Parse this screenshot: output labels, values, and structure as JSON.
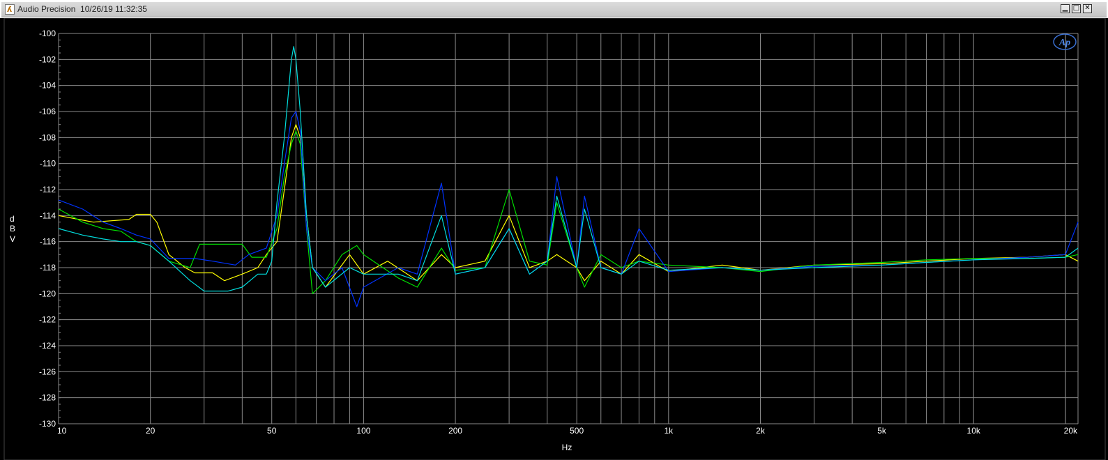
{
  "window": {
    "title": "Audio Precision  10/26/19 11:32:35",
    "icon": "audio-precision-app-icon",
    "buttons": [
      "minimize",
      "maximize",
      "close"
    ]
  },
  "logo": {
    "text": "AP"
  },
  "chart_data": {
    "type": "line",
    "title": "",
    "xlabel": "Hz",
    "ylabel": "dBV",
    "x_scale": "log",
    "xlim": [
      10,
      22000
    ],
    "ylim": [
      -130,
      -100
    ],
    "grid": true,
    "x_tick_labels": [
      {
        "value": 10,
        "label": "10"
      },
      {
        "value": 20,
        "label": "20"
      },
      {
        "value": 50,
        "label": "50"
      },
      {
        "value": 100,
        "label": "100"
      },
      {
        "value": 200,
        "label": "200"
      },
      {
        "value": 500,
        "label": "500"
      },
      {
        "value": 1000,
        "label": "1k"
      },
      {
        "value": 2000,
        "label": "2k"
      },
      {
        "value": 5000,
        "label": "5k"
      },
      {
        "value": 10000,
        "label": "10k"
      },
      {
        "value": 20000,
        "label": "20k"
      }
    ],
    "y_ticks": [
      -100,
      -102,
      -104,
      -106,
      -108,
      -110,
      -112,
      -114,
      -116,
      -118,
      -120,
      -122,
      -124,
      -126,
      -128,
      -130
    ],
    "colors": {
      "background": "#000000",
      "grid": "#8a8a8a",
      "text": "#ffffff"
    },
    "series": [
      {
        "color": "#ffff00",
        "points": [
          [
            10,
            -114
          ],
          [
            13,
            -114.5
          ],
          [
            17,
            -114.3
          ],
          [
            18,
            -113.9
          ],
          [
            20,
            -113.9
          ],
          [
            21,
            -114.5
          ],
          [
            23,
            -117
          ],
          [
            26,
            -118
          ],
          [
            28,
            -118.4
          ],
          [
            32,
            -118.4
          ],
          [
            35,
            -119
          ],
          [
            40,
            -118.5
          ],
          [
            45,
            -118
          ],
          [
            48,
            -117
          ],
          [
            52,
            -116
          ],
          [
            55,
            -112
          ],
          [
            58,
            -108
          ],
          [
            60,
            -107
          ],
          [
            62,
            -108
          ],
          [
            65,
            -114
          ],
          [
            68,
            -118
          ],
          [
            75,
            -119.5
          ],
          [
            90,
            -117
          ],
          [
            100,
            -118.5
          ],
          [
            120,
            -117.5
          ],
          [
            150,
            -119
          ],
          [
            180,
            -117
          ],
          [
            200,
            -118
          ],
          [
            250,
            -117.5
          ],
          [
            300,
            -114
          ],
          [
            350,
            -118
          ],
          [
            400,
            -117.5
          ],
          [
            430,
            -117
          ],
          [
            500,
            -118
          ],
          [
            530,
            -119
          ],
          [
            600,
            -117.5
          ],
          [
            700,
            -118.5
          ],
          [
            800,
            -117
          ],
          [
            1000,
            -118.3
          ],
          [
            1500,
            -117.8
          ],
          [
            2000,
            -118.2
          ],
          [
            3000,
            -117.8
          ],
          [
            5000,
            -117.7
          ],
          [
            7000,
            -117.5
          ],
          [
            10000,
            -117.3
          ],
          [
            15000,
            -117.2
          ],
          [
            20000,
            -117
          ],
          [
            22000,
            -117.5
          ]
        ]
      },
      {
        "color": "#00dd00",
        "points": [
          [
            10,
            -113.5
          ],
          [
            12,
            -114.5
          ],
          [
            14,
            -115
          ],
          [
            16,
            -115.2
          ],
          [
            18,
            -116
          ],
          [
            20,
            -116.3
          ],
          [
            23,
            -117.5
          ],
          [
            27,
            -118
          ],
          [
            29,
            -116.2
          ],
          [
            35,
            -116.2
          ],
          [
            40,
            -116.2
          ],
          [
            43,
            -117.2
          ],
          [
            48,
            -117.2
          ],
          [
            52,
            -115
          ],
          [
            55,
            -111
          ],
          [
            58,
            -108.5
          ],
          [
            60,
            -107.5
          ],
          [
            62,
            -108.5
          ],
          [
            65,
            -115
          ],
          [
            68,
            -120
          ],
          [
            75,
            -119
          ],
          [
            85,
            -117
          ],
          [
            95,
            -116.3
          ],
          [
            100,
            -117
          ],
          [
            130,
            -118.8
          ],
          [
            150,
            -119.5
          ],
          [
            180,
            -116.5
          ],
          [
            200,
            -118.2
          ],
          [
            250,
            -118
          ],
          [
            300,
            -112
          ],
          [
            350,
            -117.5
          ],
          [
            400,
            -117.8
          ],
          [
            430,
            -113
          ],
          [
            500,
            -118
          ],
          [
            530,
            -119.5
          ],
          [
            600,
            -117
          ],
          [
            700,
            -118
          ],
          [
            800,
            -117.5
          ],
          [
            1000,
            -117.8
          ],
          [
            1500,
            -118
          ],
          [
            2000,
            -118.3
          ],
          [
            3000,
            -117.8
          ],
          [
            5000,
            -117.6
          ],
          [
            7000,
            -117.4
          ],
          [
            10000,
            -117.3
          ],
          [
            15000,
            -117.3
          ],
          [
            20000,
            -117.2
          ],
          [
            22000,
            -117
          ]
        ]
      },
      {
        "color": "#0033ff",
        "points": [
          [
            10,
            -112.8
          ],
          [
            12,
            -113.5
          ],
          [
            14,
            -114.5
          ],
          [
            16,
            -115
          ],
          [
            18,
            -115.5
          ],
          [
            20,
            -115.8
          ],
          [
            23,
            -117.3
          ],
          [
            28,
            -117.3
          ],
          [
            32,
            -117.5
          ],
          [
            38,
            -117.8
          ],
          [
            42,
            -117
          ],
          [
            48,
            -116.5
          ],
          [
            52,
            -114
          ],
          [
            55,
            -110
          ],
          [
            58,
            -106.5
          ],
          [
            60,
            -106
          ],
          [
            62,
            -107.5
          ],
          [
            65,
            -115
          ],
          [
            68,
            -118
          ],
          [
            75,
            -119
          ],
          [
            85,
            -118
          ],
          [
            95,
            -121
          ],
          [
            100,
            -119.5
          ],
          [
            130,
            -118
          ],
          [
            150,
            -118.5
          ],
          [
            180,
            -111.5
          ],
          [
            200,
            -118.5
          ],
          [
            250,
            -118
          ],
          [
            300,
            -115
          ],
          [
            350,
            -118.5
          ],
          [
            400,
            -117.5
          ],
          [
            430,
            -111
          ],
          [
            500,
            -118
          ],
          [
            530,
            -112.5
          ],
          [
            600,
            -118
          ],
          [
            700,
            -118.5
          ],
          [
            800,
            -115
          ],
          [
            1000,
            -118.3
          ],
          [
            1500,
            -118
          ],
          [
            2000,
            -118.2
          ],
          [
            3000,
            -117.9
          ],
          [
            5000,
            -117.8
          ],
          [
            7000,
            -117.6
          ],
          [
            10000,
            -117.4
          ],
          [
            15000,
            -117.2
          ],
          [
            20000,
            -117
          ],
          [
            22000,
            -114.5
          ]
        ]
      },
      {
        "color": "#00dddd",
        "points": [
          [
            10,
            -115
          ],
          [
            12,
            -115.5
          ],
          [
            14,
            -115.8
          ],
          [
            16,
            -116
          ],
          [
            18,
            -116
          ],
          [
            20,
            -116.3
          ],
          [
            23,
            -117.5
          ],
          [
            27,
            -119
          ],
          [
            30,
            -119.8
          ],
          [
            36,
            -119.8
          ],
          [
            40,
            -119.5
          ],
          [
            45,
            -118.5
          ],
          [
            48,
            -118.5
          ],
          [
            50,
            -117.5
          ],
          [
            52,
            -113
          ],
          [
            55,
            -108
          ],
          [
            58,
            -102
          ],
          [
            59,
            -101
          ],
          [
            60,
            -102
          ],
          [
            62,
            -106
          ],
          [
            65,
            -114
          ],
          [
            68,
            -118
          ],
          [
            75,
            -119.5
          ],
          [
            90,
            -118
          ],
          [
            100,
            -118.5
          ],
          [
            130,
            -118.5
          ],
          [
            150,
            -119
          ],
          [
            180,
            -114
          ],
          [
            200,
            -118.5
          ],
          [
            250,
            -118
          ],
          [
            300,
            -115
          ],
          [
            350,
            -118.5
          ],
          [
            400,
            -117.5
          ],
          [
            430,
            -112.5
          ],
          [
            500,
            -118
          ],
          [
            530,
            -113.5
          ],
          [
            600,
            -118
          ],
          [
            700,
            -118.5
          ],
          [
            800,
            -117.5
          ],
          [
            1000,
            -118.2
          ],
          [
            1500,
            -118
          ],
          [
            2000,
            -118.2
          ],
          [
            3000,
            -118
          ],
          [
            5000,
            -117.8
          ],
          [
            7000,
            -117.6
          ],
          [
            10000,
            -117.4
          ],
          [
            15000,
            -117.3
          ],
          [
            20000,
            -117.2
          ],
          [
            22000,
            -116.5
          ]
        ]
      }
    ]
  }
}
